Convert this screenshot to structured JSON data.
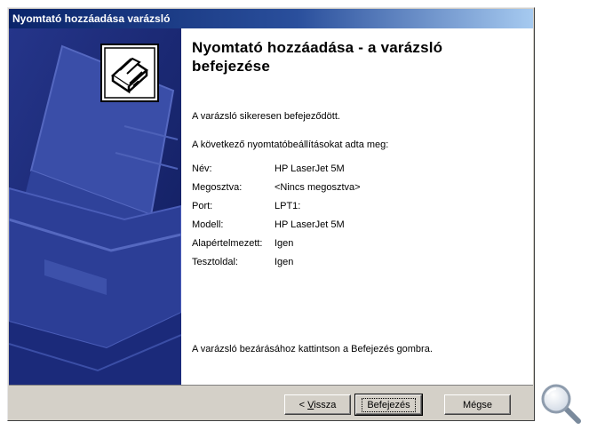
{
  "window": {
    "title": "Nyomtató hozzáadása varázsló"
  },
  "main": {
    "heading": "Nyomtató hozzáadása - a varázsló befejezése",
    "success_text": "A varázsló sikeresen befejeződött.",
    "intro_text": "A következő nyomtatóbeállításokat adta meg:",
    "settings": [
      {
        "key": "Név:",
        "value": "HP LaserJet 5M"
      },
      {
        "key": "Megosztva:",
        "value": "<Nincs megosztva>"
      },
      {
        "key": "Port:",
        "value": "LPT1:"
      },
      {
        "key": "Modell:",
        "value": "HP LaserJet 5M"
      },
      {
        "key": "Alapértelmezett:",
        "value": "Igen"
      },
      {
        "key": "Tesztoldal:",
        "value": "Igen"
      }
    ],
    "closing_text": "A varázsló bezárásához kattintson a Befejezés gombra."
  },
  "buttons": {
    "back_prefix": "< ",
    "back_mnemonic": "V",
    "back_rest": "issza",
    "finish": "Befejezés",
    "cancel": "Mégse"
  },
  "icons": {
    "wizard": "printer-icon",
    "zoom": "magnifier-icon"
  },
  "colors": {
    "titlebar": "#0a246a",
    "sidebar": "#14236f",
    "dialog_face": "#d4d0c8"
  }
}
